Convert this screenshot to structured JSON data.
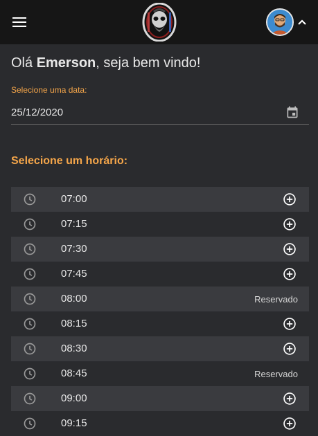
{
  "header": {
    "menu_icon": "menu-icon",
    "logo_icon": "barber-skull-logo",
    "avatar_icon": "user-avatar",
    "chevron_icon": "chevron-up-icon"
  },
  "greeting": {
    "prefix": "Olá ",
    "name": "Emerson",
    "suffix": ", seja bem vindo!"
  },
  "date_picker": {
    "label": "Selecione uma data:",
    "value": "25/12/2020",
    "icon": "calendar-icon"
  },
  "slots_section": {
    "title": "Selecione um horário:",
    "reserved_label": "Reservado",
    "slots": [
      {
        "time": "07:00",
        "reserved": false
      },
      {
        "time": "07:15",
        "reserved": false
      },
      {
        "time": "07:30",
        "reserved": false
      },
      {
        "time": "07:45",
        "reserved": false
      },
      {
        "time": "08:00",
        "reserved": true
      },
      {
        "time": "08:15",
        "reserved": false
      },
      {
        "time": "08:30",
        "reserved": false
      },
      {
        "time": "08:45",
        "reserved": true
      },
      {
        "time": "09:00",
        "reserved": false
      },
      {
        "time": "09:15",
        "reserved": false
      }
    ]
  },
  "colors": {
    "accent": "#f5a64a",
    "topbar": "#161616",
    "background": "#2a2b2e",
    "row_alt": "#3a3b3f"
  }
}
